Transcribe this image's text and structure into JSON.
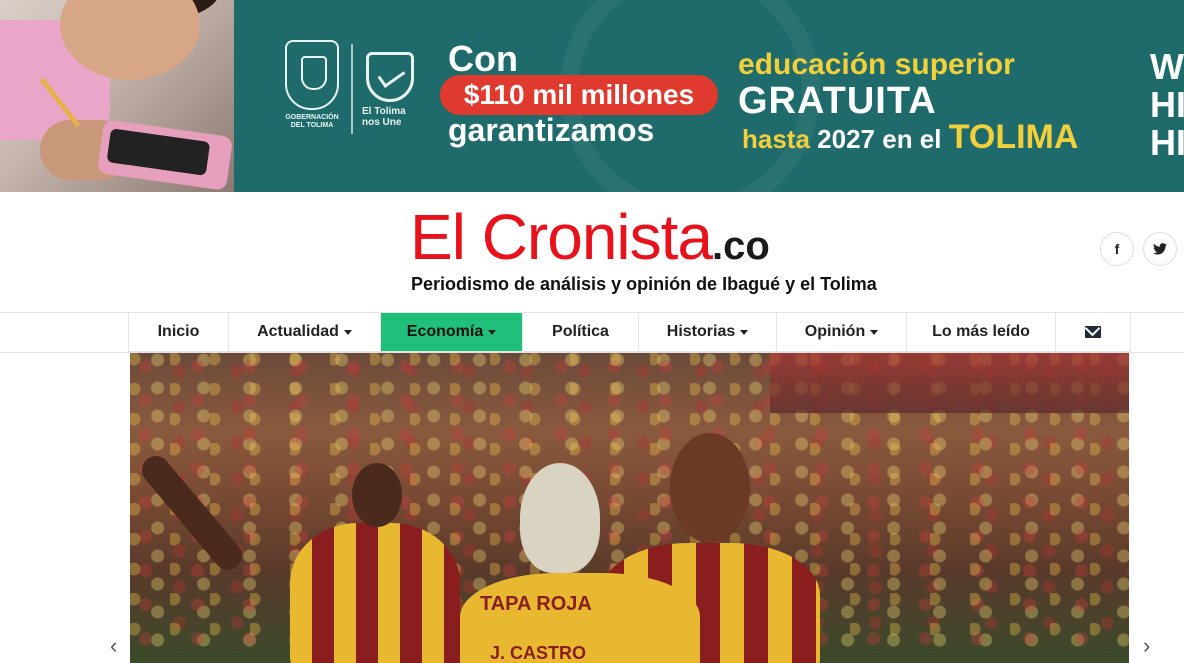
{
  "banner": {
    "seal_text": "GOBERNACIÓN DEL TOLIMA",
    "tolima_logo_text": "El Tolima nos Une",
    "con": "Con",
    "amount": "$110 mil millones",
    "garantizamos": "garantizamos",
    "edu": "educación superior",
    "gratuita": "GRATUITA",
    "hasta_prefix": "hasta",
    "hasta_year": "2027",
    "hasta_mid": "en el",
    "tolima": "TOLIMA",
    "edge_text": "W HIC HI"
  },
  "header": {
    "logo_main": "El Cronista",
    "logo_tld": ".co",
    "tagline": "Periodismo de análisis y opinión de Ibagué y el Tolima",
    "social": {
      "facebook": "f",
      "twitter": "🐦"
    }
  },
  "nav": {
    "items": [
      {
        "label": "Inicio"
      },
      {
        "label": "Actualidad"
      },
      {
        "label": "Economía"
      },
      {
        "label": "Política"
      },
      {
        "label": "Historias"
      },
      {
        "label": "Opinión"
      },
      {
        "label": "Lo más leído"
      }
    ]
  },
  "hero": {
    "jersey_1": "TAPA ROJA",
    "jersey_2": "J. CASTRO"
  },
  "carousel": {
    "prev": "‹",
    "next": "›"
  }
}
